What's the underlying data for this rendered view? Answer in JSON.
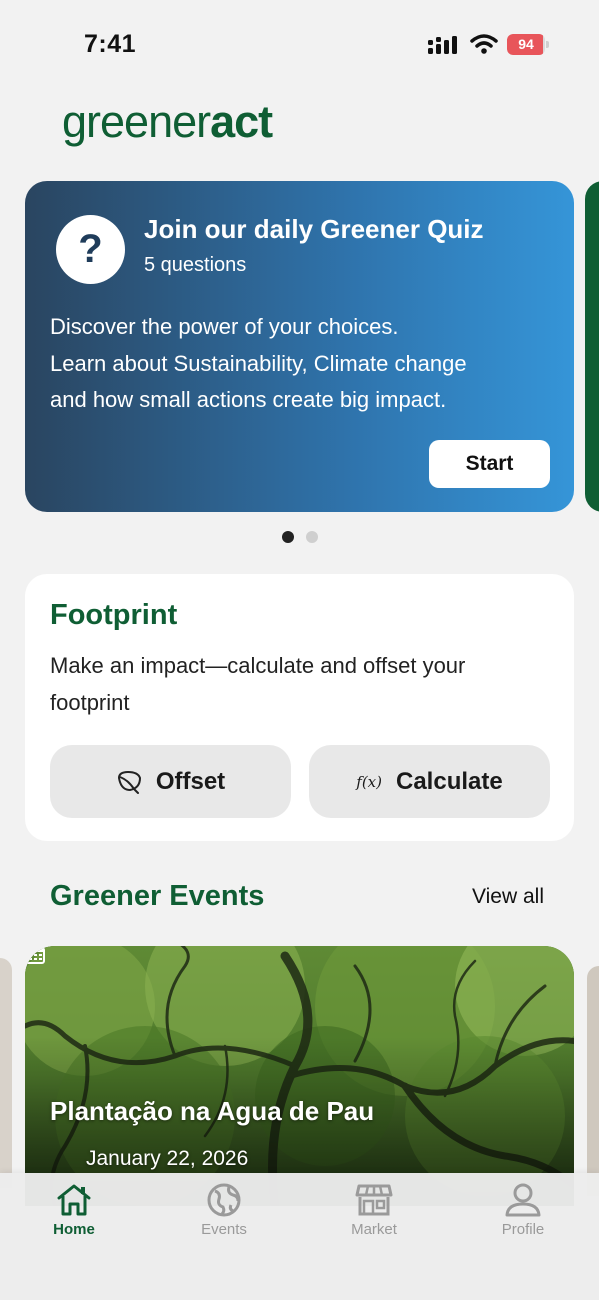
{
  "status_bar": {
    "time": "7:41",
    "battery": "94",
    "battery_level": 0.94
  },
  "app": {
    "logo_light": "greener",
    "logo_bold": "act",
    "brand_color": "#0f5e34"
  },
  "quiz": {
    "icon": "question-mark-icon",
    "icon_glyph": "?",
    "title": "Join our daily Greener Quiz",
    "subtitle": "5 questions",
    "description_lines": [
      "Discover the power of your choices.",
      "Learn about Sustainability, Climate change",
      "and how small actions create big impact."
    ],
    "start_label": "Start"
  },
  "carousel": {
    "page_count": 2,
    "active_index": 0
  },
  "footprint": {
    "title": "Footprint",
    "description": "Make an impact—calculate and offset your footprint",
    "offset_label": "Offset",
    "offset_icon": "leaf-icon",
    "calculate_label": "Calculate",
    "calculate_icon": "function-icon",
    "calculate_icon_text": "f(x)"
  },
  "events": {
    "heading": "Greener Events",
    "view_all_label": "View all",
    "items": [
      {
        "title": "Plantação na Agua de Pau",
        "date": "January 22, 2026",
        "date_icon": "calendar-icon"
      }
    ]
  },
  "tab_bar": {
    "tabs": [
      {
        "label": "Home",
        "icon": "home-icon",
        "active": true
      },
      {
        "label": "Events",
        "icon": "globe-icon",
        "active": false
      },
      {
        "label": "Market",
        "icon": "storefront-icon",
        "active": false
      },
      {
        "label": "Profile",
        "icon": "person-icon",
        "active": false
      }
    ]
  }
}
